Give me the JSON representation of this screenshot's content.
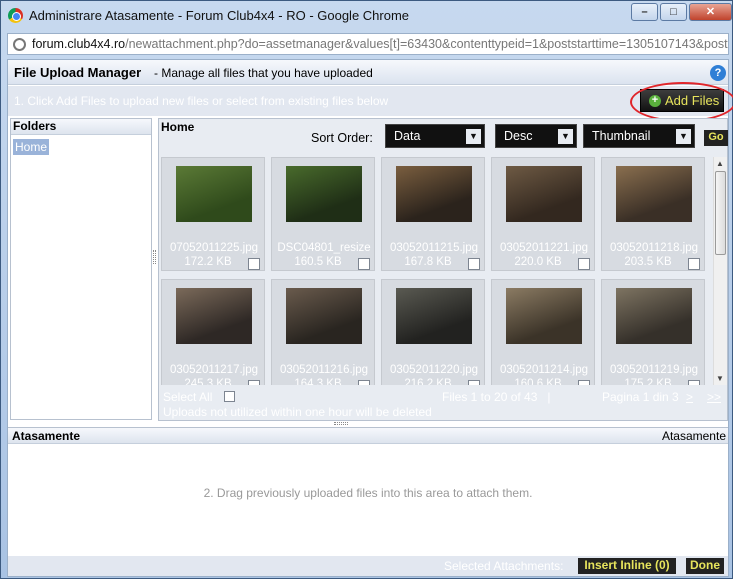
{
  "window": {
    "title": "Administrare Atasamente - Forum Club4x4 - RO - Google Chrome",
    "controls": [
      "minimize",
      "maximize",
      "close"
    ]
  },
  "address": {
    "host": "forum.club4x4.ro",
    "path": "/newattachment.php?do=assetmanager&values[t]=63430&contenttypeid=1&poststarttime=1305107143&posthash"
  },
  "header": {
    "title": "File Upload Manager",
    "subtitle": "- Manage all files that you have uploaded",
    "help": "?"
  },
  "instructions": "1. Click Add Files to upload new files or select from existing files below",
  "add_files": {
    "label": "Add Files",
    "icon": "+"
  },
  "folders": {
    "title": "Folders",
    "items": [
      "Home"
    ]
  },
  "browser": {
    "title": "Home",
    "sort_label": "Sort Order:",
    "sort_field": "Data",
    "sort_dir": "Desc",
    "view": "Thumbnail",
    "go": "Go",
    "files": [
      {
        "name": "07052011225.jpg",
        "size": "172.2 KB",
        "c1": "#5b7a36",
        "c2": "#2f4a1b"
      },
      {
        "name": "DSC04801_resize",
        "size": "160.5 KB",
        "c1": "#496b2c",
        "c2": "#1f2e16"
      },
      {
        "name": "03052011215.jpg",
        "size": "167.8 KB",
        "c1": "#7a5e3f",
        "c2": "#2b231c"
      },
      {
        "name": "03052011221.jpg",
        "size": "220.0 KB",
        "c1": "#6e5a44",
        "c2": "#33281f"
      },
      {
        "name": "03052011218.jpg",
        "size": "203.5 KB",
        "c1": "#8a6f4f",
        "c2": "#3a2f26"
      },
      {
        "name": "03052011217.jpg",
        "size": "245.3 KB",
        "c1": "#7b6a5a",
        "c2": "#2e2825"
      },
      {
        "name": "03052011216.jpg",
        "size": "164.3 KB",
        "c1": "#6a5b4d",
        "c2": "#292520"
      },
      {
        "name": "03052011220.jpg",
        "size": "216.2 KB",
        "c1": "#5a5a52",
        "c2": "#222220"
      },
      {
        "name": "03052011214.jpg",
        "size": "160.6 KB",
        "c1": "#8b7b63",
        "c2": "#3b3328"
      },
      {
        "name": "03052011219.jpg",
        "size": "175.2 KB",
        "c1": "#7e7462",
        "c2": "#35302a"
      }
    ],
    "select_all": "Select All",
    "files_count": "Files 1 to 20 of 43",
    "separator": "|",
    "pagina": "Pagina 1 din 3",
    "nav_next": ">",
    "nav_last": ">>",
    "uploads_note": "Uploads not utilized within one hour will be deleted"
  },
  "attachments": {
    "title": "Atasamente",
    "right_label": "Atasamente",
    "drag_hint": "2. Drag previously uploaded files into this area to attach them.",
    "selected_label": "Selected Attachments:",
    "insert_inline": "Insert Inline (0)",
    "done": "Done"
  }
}
